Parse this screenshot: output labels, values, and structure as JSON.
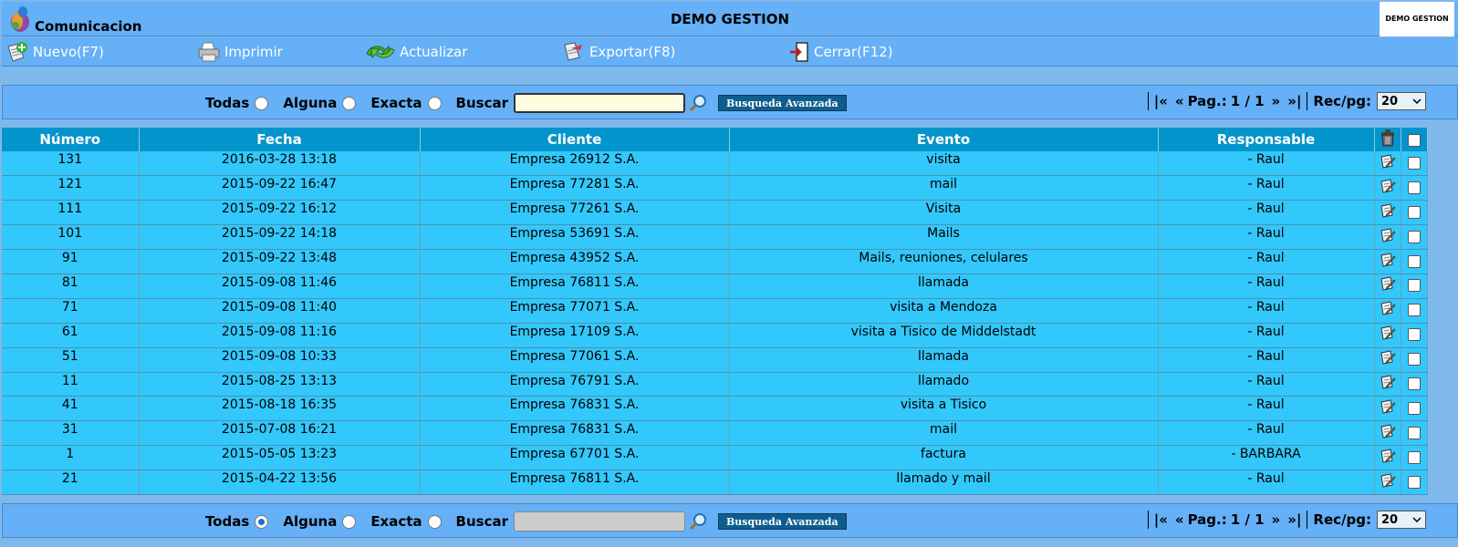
{
  "header": {
    "app_title": "Comunicacion",
    "center_title": "DEMO GESTION",
    "company_label": "DEMO GESTION"
  },
  "toolbar": {
    "nuevo": "Nuevo(F7)",
    "imprimir": "Imprimir",
    "actualizar": "Actualizar",
    "exportar": "Exportar(F8)",
    "cerrar": "Cerrar(F12)"
  },
  "search": {
    "todas": "Todas",
    "alguna": "Alguna",
    "exacta": "Exacta",
    "buscar": "Buscar",
    "advanced": "Busqueda Avanzada",
    "first": "|«",
    "prev": "«",
    "page_label": "Pag.:",
    "page_value": "1 / 1",
    "next": "»",
    "last": "»|",
    "rec_label": "Rec/pg:",
    "rec_value": "20"
  },
  "table": {
    "columns": [
      "Número",
      "Fecha",
      "Cliente",
      "Evento",
      "Responsable"
    ],
    "rows": [
      {
        "numero": "131",
        "fecha": "2016-03-28 13:18",
        "cliente": "Empresa 26912 S.A.",
        "evento": "visita",
        "responsable": "- Raul"
      },
      {
        "numero": "121",
        "fecha": "2015-09-22 16:47",
        "cliente": "Empresa 77281 S.A.",
        "evento": "mail",
        "responsable": "- Raul"
      },
      {
        "numero": "111",
        "fecha": "2015-09-22 16:12",
        "cliente": "Empresa 77261 S.A.",
        "evento": "Visita",
        "responsable": "- Raul"
      },
      {
        "numero": "101",
        "fecha": "2015-09-22 14:18",
        "cliente": "Empresa 53691 S.A.",
        "evento": "Mails",
        "responsable": "- Raul"
      },
      {
        "numero": "91",
        "fecha": "2015-09-22 13:48",
        "cliente": "Empresa 43952 S.A.",
        "evento": "Mails, reuniones, celulares",
        "responsable": "- Raul"
      },
      {
        "numero": "81",
        "fecha": "2015-09-08 11:46",
        "cliente": "Empresa 76811 S.A.",
        "evento": "llamada",
        "responsable": "- Raul"
      },
      {
        "numero": "71",
        "fecha": "2015-09-08 11:40",
        "cliente": "Empresa 77071 S.A.",
        "evento": "visita a Mendoza",
        "responsable": "- Raul"
      },
      {
        "numero": "61",
        "fecha": "2015-09-08 11:16",
        "cliente": "Empresa 17109 S.A.",
        "evento": "visita a Tisico de Middelstadt",
        "responsable": "- Raul"
      },
      {
        "numero": "51",
        "fecha": "2015-09-08 10:33",
        "cliente": "Empresa 77061 S.A.",
        "evento": "llamada",
        "responsable": "- Raul"
      },
      {
        "numero": "11",
        "fecha": "2015-08-25 13:13",
        "cliente": "Empresa 76791 S.A.",
        "evento": "llamado",
        "responsable": "- Raul"
      },
      {
        "numero": "41",
        "fecha": "2015-08-18 16:35",
        "cliente": "Empresa 76831 S.A.",
        "evento": "visita a Tisico",
        "responsable": "- Raul"
      },
      {
        "numero": "31",
        "fecha": "2015-07-08 16:21",
        "cliente": "Empresa 76831 S.A.",
        "evento": "mail",
        "responsable": "- Raul"
      },
      {
        "numero": "1",
        "fecha": "2015-05-05 13:23",
        "cliente": "Empresa 67701 S.A.",
        "evento": "factura",
        "responsable": "- BARBARA"
      },
      {
        "numero": "21",
        "fecha": "2015-04-22 13:56",
        "cliente": "Empresa 76811 S.A.",
        "evento": "llamado y mail",
        "responsable": "- Raul"
      }
    ]
  }
}
